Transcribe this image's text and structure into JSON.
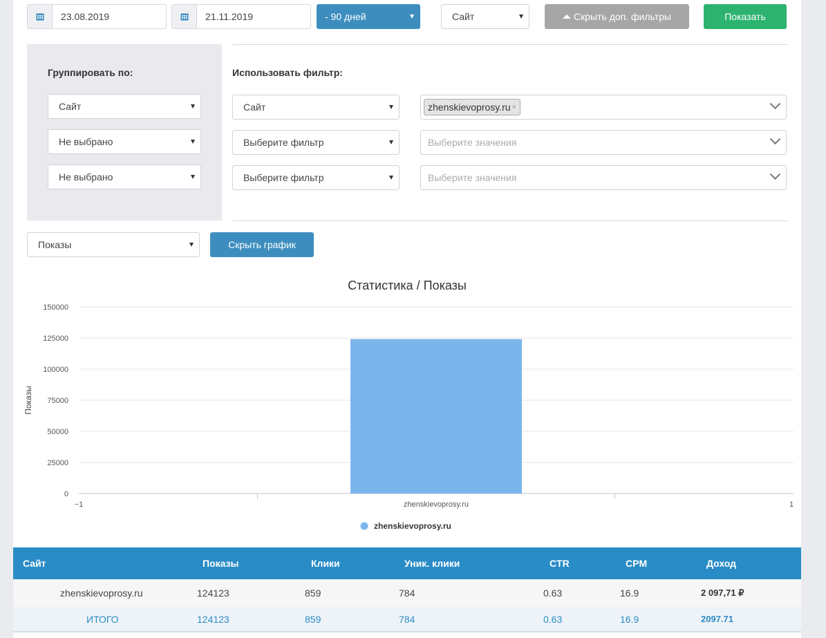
{
  "toolbar": {
    "date_from": "23.08.2019",
    "date_to": "21.11.2019",
    "period": "- 90 дней",
    "scope": "Сайт",
    "hide_filters": "Скрыть доп. фильтры",
    "show": "Показать"
  },
  "grouping": {
    "title": "Группировать по:",
    "selects": [
      "Сайт",
      "Не выбрано",
      "Не выбрано"
    ]
  },
  "filters": {
    "title": "Использовать фильтр:",
    "rows": [
      {
        "field": "Сайт",
        "tag": "zhenskievoprosy.ru",
        "placeholder": ""
      },
      {
        "field": "Выберите фильтр",
        "tag": "",
        "placeholder": "Выберите значения"
      },
      {
        "field": "Выберите фильтр",
        "tag": "",
        "placeholder": "Выберите значения"
      }
    ]
  },
  "metric": {
    "selected": "Показы",
    "hide_chart": "Скрыть график"
  },
  "colors": {
    "bar": "#7cb5ec",
    "header": "#2a8cc6",
    "green": "#2cb36f",
    "blue": "#3d8ebf"
  },
  "chart_data": {
    "type": "bar",
    "title": "Статистика / Показы",
    "ylabel": "Показы",
    "xlabel": "",
    "categories": [
      "zhenskievoprosy.ru"
    ],
    "series": [
      {
        "name": "zhenskievoprosy.ru",
        "values": [
          124123
        ]
      }
    ],
    "ylim": [
      0,
      150000
    ],
    "yticks": [
      0,
      25000,
      50000,
      75000,
      100000,
      125000,
      150000
    ],
    "x_edge_labels": [
      "−1",
      "1"
    ],
    "grid": true,
    "legend": "bottom-center"
  },
  "table": {
    "headers": [
      "Сайт",
      "Показы",
      "Клики",
      "Уник. клики",
      "CTR",
      "CPM",
      "Доход"
    ],
    "rows": [
      [
        "zhenskievoprosy.ru",
        "124123",
        "859",
        "784",
        "0.63",
        "16.9",
        "2 097,71 ₽"
      ]
    ],
    "total": [
      "ИТОГО",
      "124123",
      "859",
      "784",
      "0.63",
      "16.9",
      "2097.71"
    ]
  }
}
